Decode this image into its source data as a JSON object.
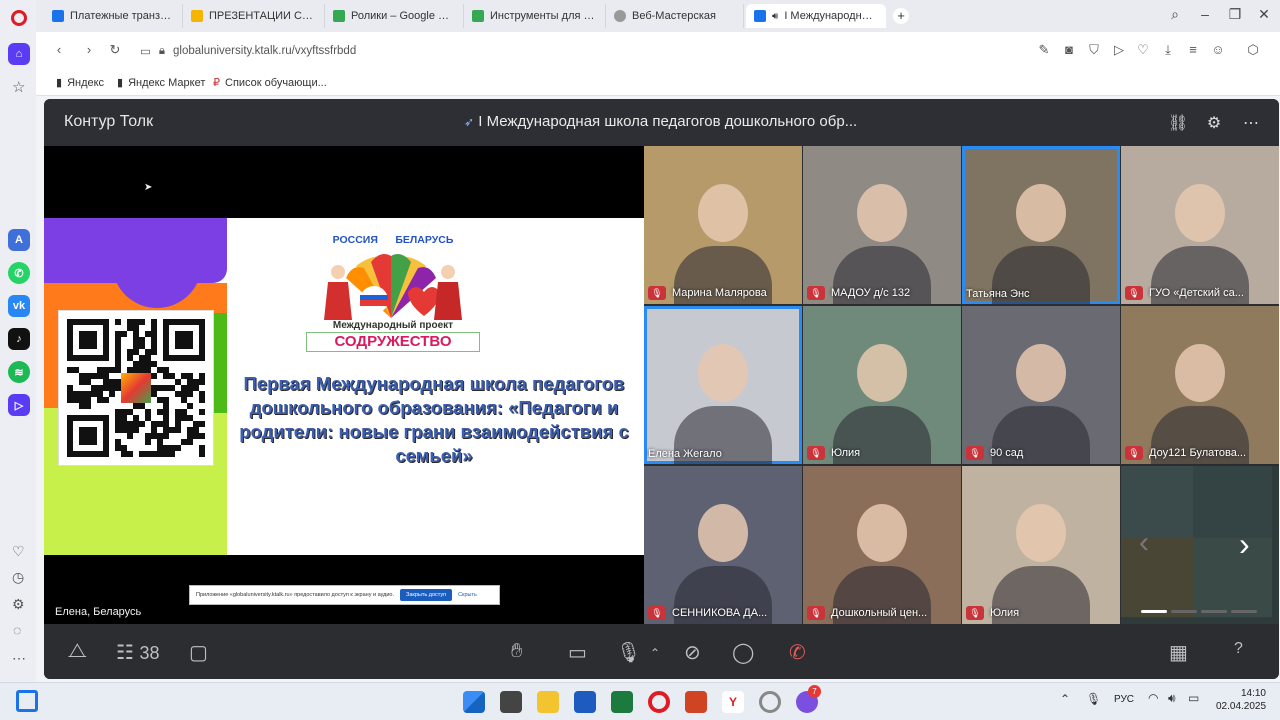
{
  "browser": {
    "tabs": [
      {
        "label": "Платежные транзакции ·",
        "color": "#1a73e8"
      },
      {
        "label": "ПРЕЗЕНТАЦИИ СПИКЕРО",
        "color": "#f4b400"
      },
      {
        "label": "Ролики – Google Диск",
        "color": "#34a853"
      },
      {
        "label": "Инструменты для кампус",
        "color": "#34a853"
      },
      {
        "label": "Веб-Мастерская",
        "color": "#999999"
      },
      {
        "label": "I Международная шк",
        "color": "#1a73e8"
      }
    ],
    "new_tab": "+",
    "url": "globaluniversity.ktalk.ru/vxyftssfrbdd",
    "bookmarks": [
      "Яндекс",
      "Яндекс Маркет",
      "Список обучающи..."
    ]
  },
  "app": {
    "brand": "Контур Толк",
    "meeting_title": "I Международная школа педагогов дошкольного обр...",
    "presenter_label": "Елена, Беларусь",
    "slide": {
      "logo_top": "РОССИЯ      БЕЛАРУСЬ",
      "logo_mid": "Международный проект",
      "logo_bottom": "СОДРУЖЕСТВО",
      "text": "Первая Международная школа педагогов дошкольного образования: «Педагоги и родители: новые грани взаимодействия с семьей»"
    },
    "notice": {
      "text": "Приложение «globaluniversity.ktalk.ru» предоставило доступ к экрану и аудио.",
      "stop": "Закрыть доступ",
      "hide": "Скрыть"
    },
    "participants": [
      {
        "name": "Марина Малярова",
        "muted": true,
        "bg": "#b79a6a"
      },
      {
        "name": "МАДОУ д/с 132",
        "muted": true,
        "bg": "#8f8b84"
      },
      {
        "name": "Татьяна Энс",
        "muted": false,
        "bg": "#7f7461",
        "highlight": true
      },
      {
        "name": "ГУО «Детский са...",
        "muted": true,
        "bg": "#b7aba0"
      },
      {
        "name": "Елена Жегало",
        "muted": false,
        "bg": "#c7c9d1",
        "highlight": true
      },
      {
        "name": "Юлия",
        "muted": true,
        "bg": "#6f8a7a"
      },
      {
        "name": "90 сад",
        "muted": true,
        "bg": "#6a6a72"
      },
      {
        "name": "Доу121 Булатова...",
        "muted": true,
        "bg": "#8f7a5e"
      },
      {
        "name": "СЕННИКОВА ДА...",
        "muted": true,
        "bg": "#5d6172"
      },
      {
        "name": "Дошкольный цен...",
        "muted": true,
        "bg": "#8a6e5a"
      },
      {
        "name": "Юлия",
        "muted": true,
        "bg": "#c0b2a1"
      }
    ],
    "participant_count": "38"
  },
  "taskbar": {
    "lang": "РУС",
    "time": "14:10",
    "date": "02.04.2025",
    "badge": "7"
  }
}
